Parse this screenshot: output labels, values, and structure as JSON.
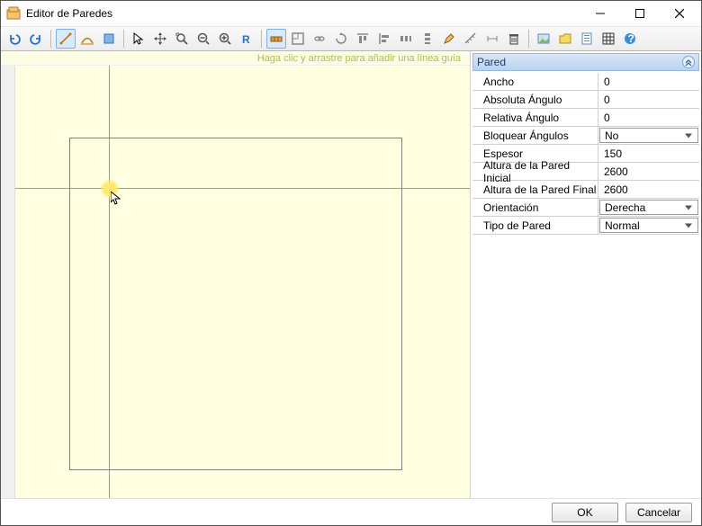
{
  "window": {
    "title": "Editor de Paredes"
  },
  "hint": "Haga clic y arrastre para añadir una línea guía",
  "panel": {
    "title": "Pared",
    "properties": [
      {
        "label": "Ancho",
        "value": "0",
        "dropdown": false
      },
      {
        "label": "Absoluta Ángulo",
        "value": "0",
        "dropdown": false
      },
      {
        "label": "Relativa Ángulo",
        "value": "0",
        "dropdown": false
      },
      {
        "label": "Bloquear Ángulos",
        "value": "No",
        "dropdown": true
      },
      {
        "label": "Espesor",
        "value": "150",
        "dropdown": false
      },
      {
        "label": "Altura de la Pared Inicial",
        "value": "2600",
        "dropdown": false
      },
      {
        "label": "Altura de la Pared Final",
        "value": "2600",
        "dropdown": false
      },
      {
        "label": "Orientación",
        "value": "Derecha",
        "dropdown": true
      },
      {
        "label": "Tipo de Pared",
        "value": "Normal",
        "dropdown": true
      }
    ]
  },
  "buttons": {
    "ok": "OK",
    "cancel": "Cancelar"
  }
}
